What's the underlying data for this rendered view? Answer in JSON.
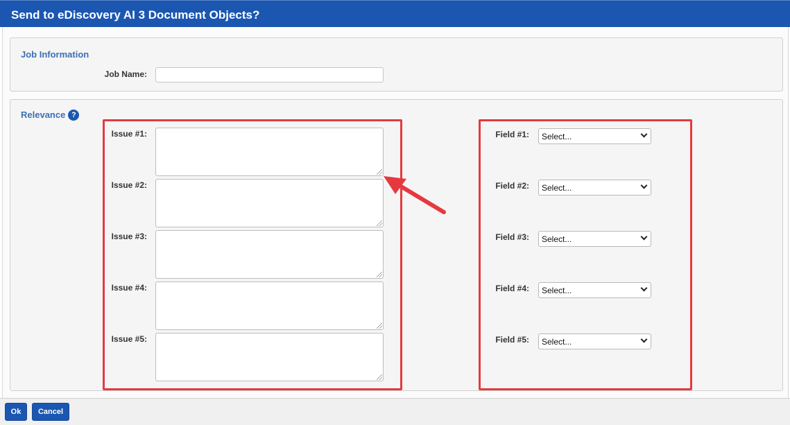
{
  "title": "Send to eDiscovery AI 3 Document Objects?",
  "job_info": {
    "section_title": "Job Information",
    "job_name_label": "Job Name:",
    "job_name_value": ""
  },
  "relevance": {
    "section_title": "Relevance",
    "help_icon_glyph": "?",
    "issues": [
      {
        "label": "Issue #1:",
        "value": ""
      },
      {
        "label": "Issue #2:",
        "value": ""
      },
      {
        "label": "Issue #3:",
        "value": ""
      },
      {
        "label": "Issue #4:",
        "value": ""
      },
      {
        "label": "Issue #5:",
        "value": ""
      }
    ],
    "fields": [
      {
        "label": "Field #1:",
        "selected": "Select..."
      },
      {
        "label": "Field #2:",
        "selected": "Select..."
      },
      {
        "label": "Field #3:",
        "selected": "Select..."
      },
      {
        "label": "Field #4:",
        "selected": "Select..."
      },
      {
        "label": "Field #5:",
        "selected": "Select..."
      }
    ]
  },
  "footer": {
    "ok_label": "Ok",
    "cancel_label": "Cancel"
  },
  "colors": {
    "title_bar": "#1b57b0",
    "section_title": "#3b6fb5",
    "highlight": "#e5393f"
  }
}
